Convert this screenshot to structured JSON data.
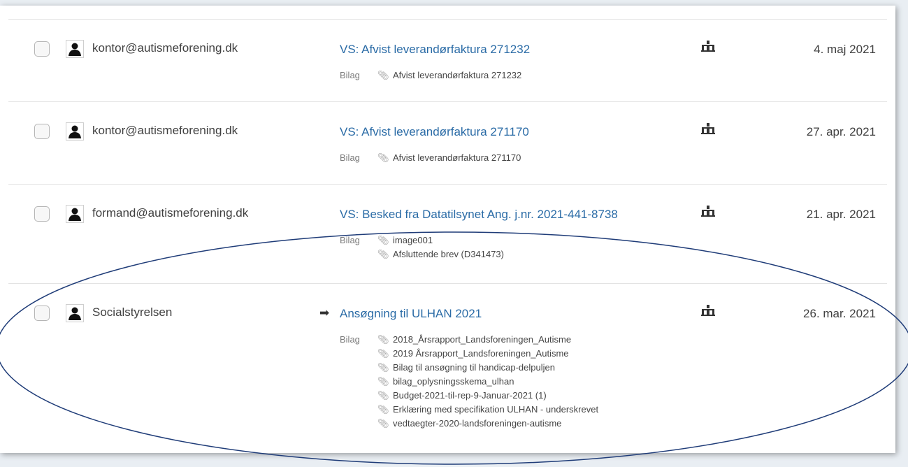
{
  "mails": [
    {
      "sender": "kontor@autismeforening.dk",
      "subject": "VS: Afvist leverandørfaktura 271232",
      "date": "4. maj 2021",
      "attachments_label": "Bilag",
      "attachments": [
        "Afvist leverandørfaktura 271232"
      ]
    },
    {
      "sender": "kontor@autismeforening.dk",
      "subject": "VS: Afvist leverandørfaktura 271170",
      "date": "27. apr. 2021",
      "attachments_label": "Bilag",
      "attachments": [
        "Afvist leverandørfaktura 271170"
      ]
    },
    {
      "sender": "formand@autismeforening.dk",
      "subject": "VS: Besked fra Datatilsynet Ang. j.nr. 2021-441-8738",
      "date": "21. apr. 2021",
      "attachments_label": "Bilag",
      "attachments": [
        "image001",
        "Afsluttende brev (D341473)"
      ]
    },
    {
      "sender": "Socialstyrelsen",
      "subject": "Ansøgning til ULHAN 2021",
      "date": "26. mar. 2021",
      "attachments_label": "Bilag",
      "attachments": [
        "2018_Årsrapport_Landsforeningen_Autisme",
        "2019 Årsrapport_Landsforeningen_Autisme",
        "Bilag til ansøgning til handicap-delpuljen",
        "bilag_oplysningsskema_ulhan",
        "Budget-2021-til-rep-9-Januar-2021 (1)",
        "Erklæring med specifikation ULHAN - underskrevet",
        "vedtaegter-2020-landsforeningen-autisme"
      ]
    }
  ],
  "icons": {
    "checkbox": "checkbox",
    "avatar": "person-icon",
    "paperclip": "paperclip-icon",
    "flag": "hierarchy-icon",
    "forward": "forward-arrow-icon"
  },
  "colors": {
    "subject_link": "#2a6ba6",
    "annotation_ellipse": "#1f3c78"
  }
}
